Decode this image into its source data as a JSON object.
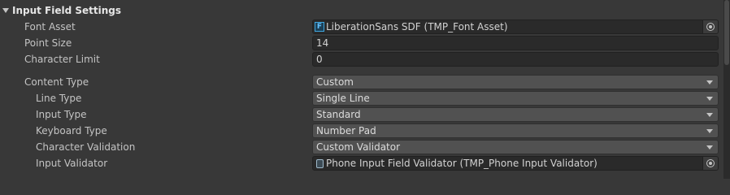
{
  "section": {
    "title": "Input Field Settings"
  },
  "fields": {
    "font_asset": {
      "label": "Font Asset",
      "value": "LiberationSans SDF (TMP_Font Asset)",
      "icon": "font-asset-icon"
    },
    "point_size": {
      "label": "Point Size",
      "value": "14"
    },
    "character_limit": {
      "label": "Character Limit",
      "value": "0"
    },
    "content_type": {
      "label": "Content Type",
      "value": "Custom"
    },
    "line_type": {
      "label": "Line Type",
      "value": "Single Line"
    },
    "input_type": {
      "label": "Input Type",
      "value": "Standard"
    },
    "keyboard_type": {
      "label": "Keyboard Type",
      "value": "Number Pad"
    },
    "character_validation": {
      "label": "Character Validation",
      "value": "Custom Validator"
    },
    "input_validator": {
      "label": "Input Validator",
      "value": "Phone Input Field Validator (TMP_Phone Input Validator)",
      "icon": "script-icon"
    }
  },
  "colors": {
    "background": "#383838",
    "field_background": "#2a2a2a",
    "dropdown_background": "#515151",
    "font_asset_icon": "#3fa7e0"
  }
}
